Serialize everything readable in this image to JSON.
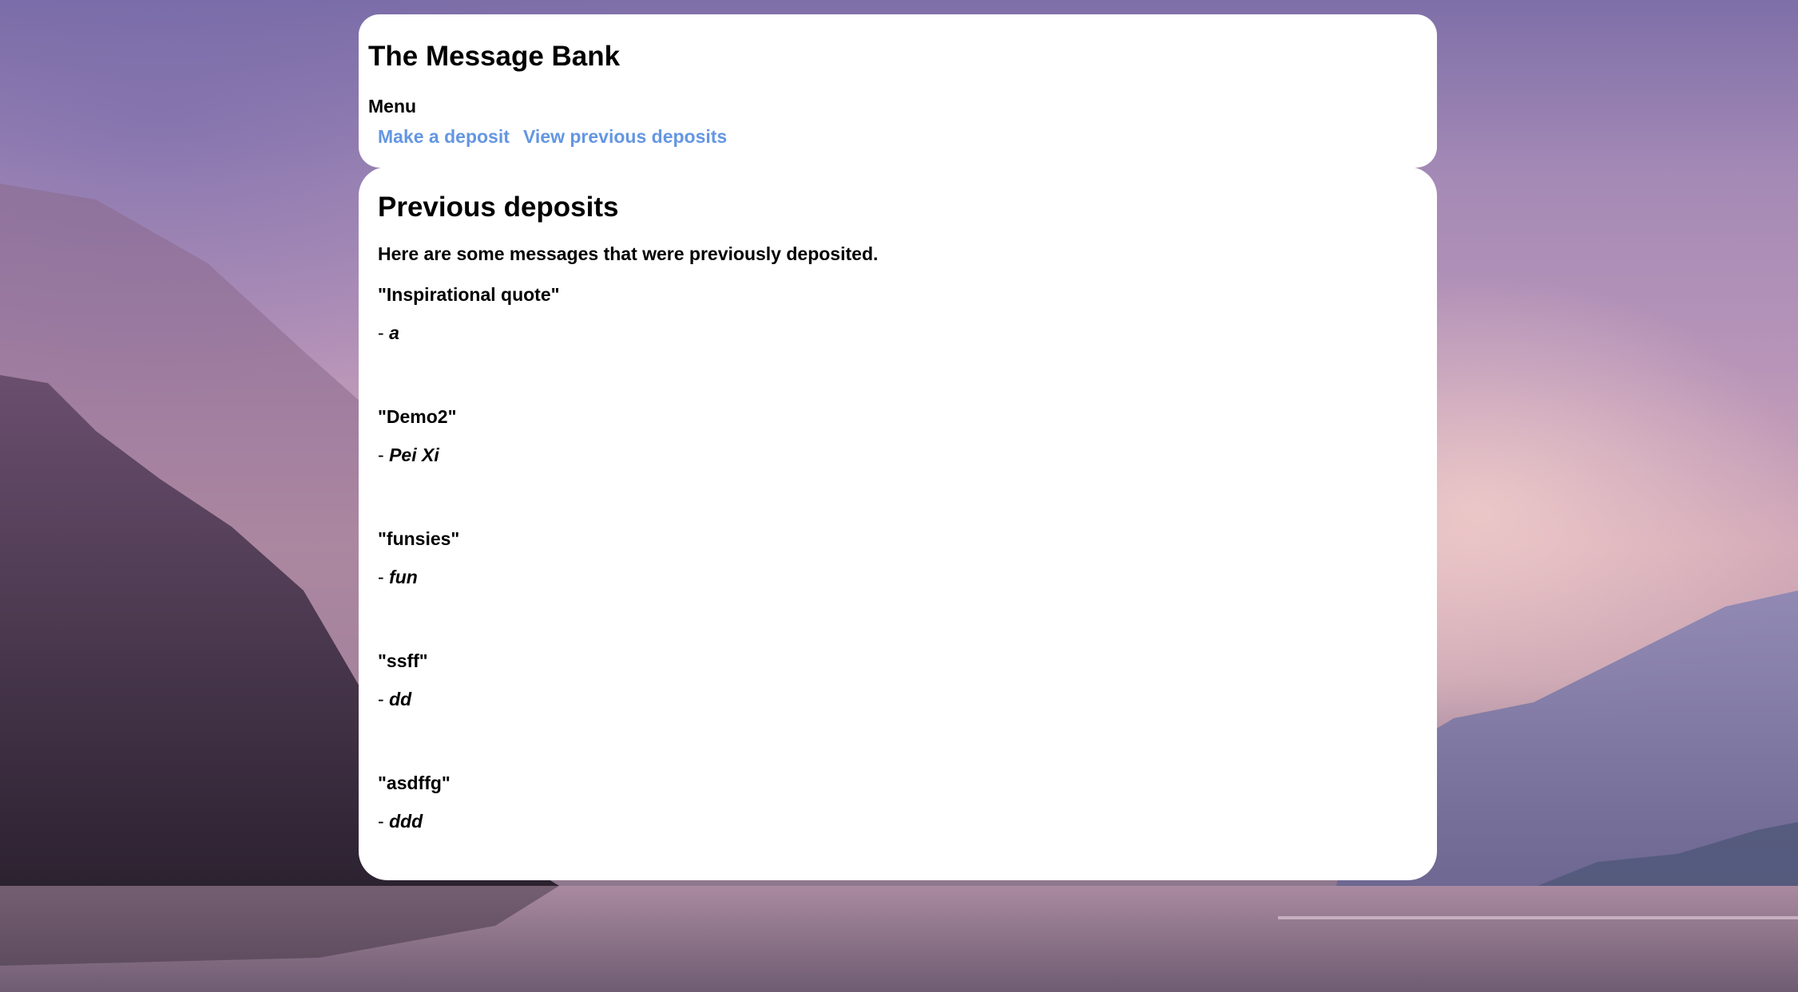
{
  "header": {
    "title": "The Message Bank",
    "menu_label": "Menu",
    "links": [
      {
        "label": "Make a deposit"
      },
      {
        "label": "View previous deposits"
      }
    ]
  },
  "main": {
    "heading": "Previous deposits",
    "intro": "Here are some messages that were previously deposited.",
    "deposits": [
      {
        "message": "\"Inspirational quote\"",
        "dash": "- ",
        "author": "a"
      },
      {
        "message": "\"Demo2\"",
        "dash": "- ",
        "author": "Pei Xi"
      },
      {
        "message": "\"funsies\"",
        "dash": "- ",
        "author": "fun"
      },
      {
        "message": "\"ssff\"",
        "dash": "- ",
        "author": "dd"
      },
      {
        "message": "\"asdffg\"",
        "dash": "- ",
        "author": "ddd"
      }
    ]
  },
  "colors": {
    "link": "#6496e2",
    "card": "#ffffff",
    "text": "#000000"
  }
}
